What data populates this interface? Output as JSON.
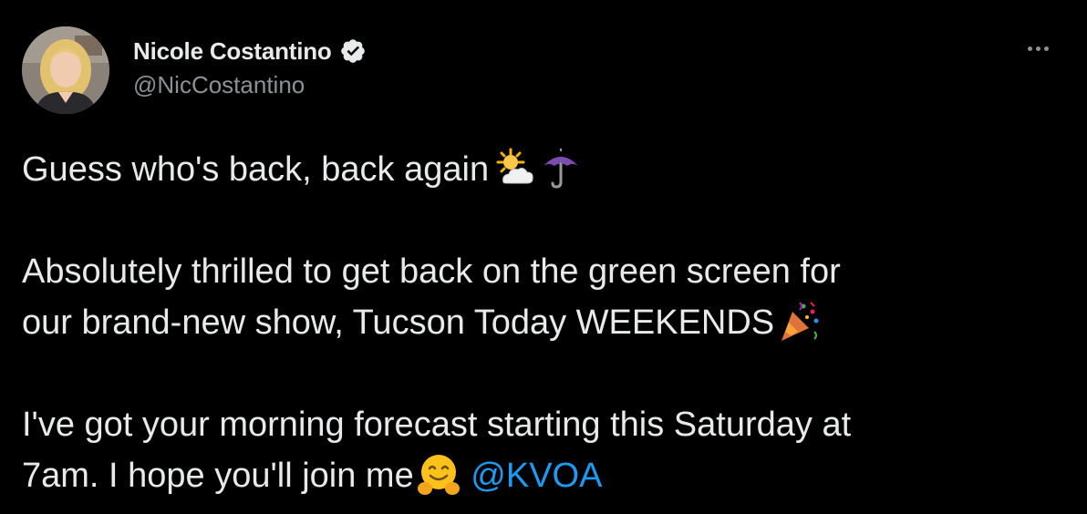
{
  "author": {
    "display_name": "Nicole Costantino",
    "handle": "@NicCostantino",
    "verified": true
  },
  "menu": {
    "icon": "more-horizontal-icon"
  },
  "tweet": {
    "line1": "Guess who's back, back again",
    "line2a": "Absolutely thrilled to get back on the green screen for",
    "line2b": "our brand-new show, Tucson Today WEEKENDS",
    "line3a": "I've got your morning forecast starting this Saturday at",
    "line3b": "7am. I hope you'll join me",
    "mention": "@KVOA"
  },
  "colors": {
    "background": "#000000",
    "text": "#e7e9ea",
    "secondary": "#8b9197",
    "link": "#1d9bf0"
  }
}
